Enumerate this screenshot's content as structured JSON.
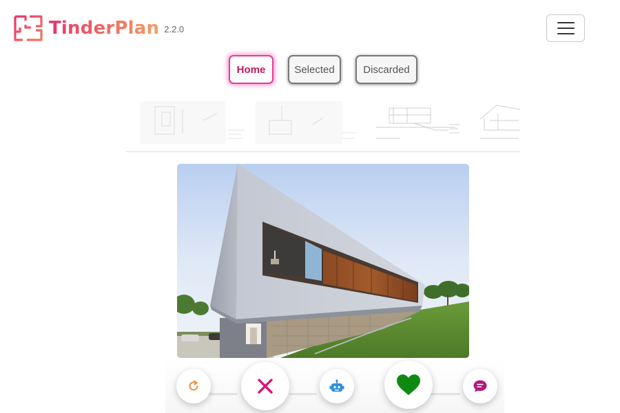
{
  "header": {
    "app_name": "TinderPlan",
    "version": "2.2.0",
    "logo_icon": "floorplan-logo-icon",
    "menu_icon": "hamburger-menu-icon"
  },
  "tabs": [
    {
      "label": "Home",
      "active": true
    },
    {
      "label": "Selected",
      "active": false
    },
    {
      "label": "Discarded",
      "active": false
    }
  ],
  "thumbnails": [
    {
      "icon": "floor-plan-thumbnail"
    },
    {
      "icon": "floor-plan-thumbnail"
    },
    {
      "icon": "section-drawing-thumbnail"
    },
    {
      "icon": "elevation-drawing-thumbnail"
    }
  ],
  "photo": {
    "icon": "modern-house-photo"
  },
  "actions": [
    {
      "icon": "undo-icon",
      "color": "#f08c3c"
    },
    {
      "icon": "close-icon",
      "color": "#d9147a"
    },
    {
      "icon": "robot-icon",
      "color": "#2f8fe0"
    },
    {
      "icon": "heart-icon",
      "color": "#0f8a10"
    },
    {
      "icon": "chat-icon",
      "color": "#b0187a"
    }
  ],
  "colors": {
    "brand_start": "#e8336d",
    "brand_end": "#f3a062",
    "active_tab": "#e33b99"
  }
}
